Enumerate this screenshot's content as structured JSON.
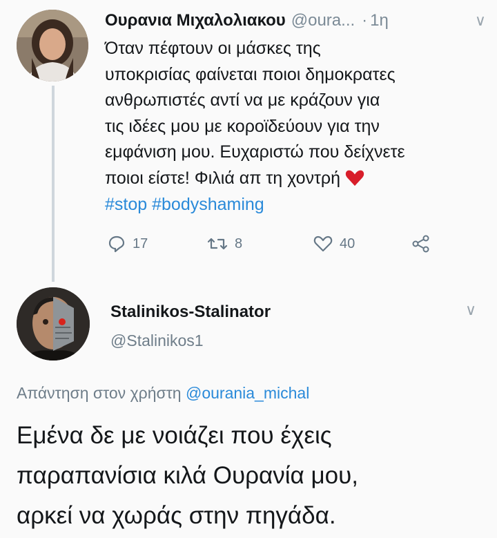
{
  "tweet": {
    "author_name": "Ουρανια Μιχαλολιακου",
    "author_handle": "@oura...",
    "separator": "·",
    "time": "1η",
    "body_lines": [
      "Όταν πέφτουν οι μάσκες της",
      "υποκρισίας φαίνεται ποιοι δημοκρατες",
      "ανθρωπιστές αντί να με κράζουν για",
      "τις ιδέες μου με κοροϊδεύουν για την",
      "εμφάνιση μου. Ευχαριστώ που δείχνετε",
      "ποιοι είστε! Φιλιά απ τη χοντρή"
    ],
    "hashtags": "#stop #bodyshaming",
    "reply_count": "17",
    "retweet_count": "8",
    "like_count": "40",
    "emoji_icon": "red-heart-icon",
    "accent_color": "#2a8ad9"
  },
  "reply": {
    "author_name": "Stalinikos-Stalinator",
    "author_handle": "@Stalinikos1",
    "replying_to_prefix": "Απάντηση στον χρήστη",
    "replying_to_mention": "@ourania_michal",
    "body_lines": [
      "Εμένα δε με νοιάζει που έχεις",
      "παραπανίσια κιλά Ουρανία μου,",
      "αρκεί να χωράς στην πηγάδα."
    ]
  }
}
